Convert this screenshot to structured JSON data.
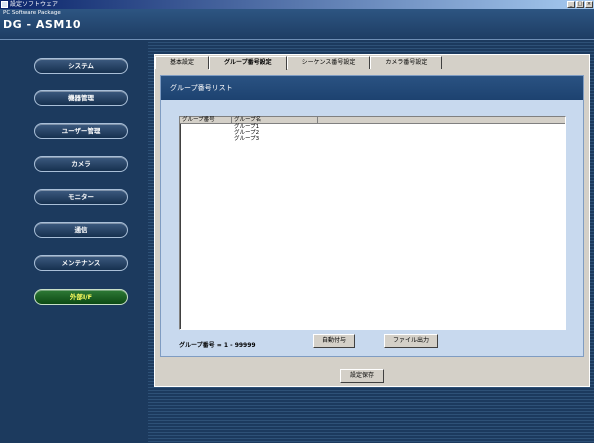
{
  "window": {
    "title": "設定ソフトウェア",
    "buttons": [
      "_",
      "□",
      "×"
    ]
  },
  "header": {
    "subtitle": "PC Software Package",
    "model": "DG - ASM10"
  },
  "sidebar": {
    "items": [
      {
        "label": "システム"
      },
      {
        "label": "機器管理"
      },
      {
        "label": "ユーザー管理"
      },
      {
        "label": "カメラ"
      },
      {
        "label": "モニター"
      },
      {
        "label": "通信"
      },
      {
        "label": "メンテナンス"
      },
      {
        "label": "外部I/F",
        "active": true
      }
    ]
  },
  "tabs": [
    {
      "label": "基本設定"
    },
    {
      "label": "グループ番号設定",
      "active": true
    },
    {
      "label": "シーケンス番号設定"
    },
    {
      "label": "カメラ番号設定"
    }
  ],
  "panel": {
    "heading": "グループ番号リスト",
    "columns": [
      "グループ番号",
      "グループ名"
    ],
    "rows": [
      {
        "number": "",
        "name": "グループ1"
      },
      {
        "number": "",
        "name": "グループ2"
      },
      {
        "number": "",
        "name": "グループ3"
      }
    ],
    "range_label": "グループ番号 = 1 - 99999",
    "auto_button": "自動付与",
    "export_button": "ファイル出力"
  },
  "save_button": "設定保存",
  "colors": {
    "background": "#1c3a5e",
    "panel": "#d4d0c8",
    "content": "#c8d9ee",
    "active_sidebar": "#1f6a26",
    "active_text": "#ffff60"
  }
}
